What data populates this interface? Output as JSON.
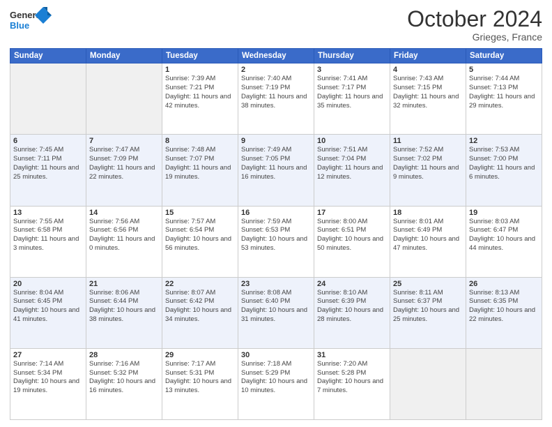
{
  "header": {
    "logo_general": "General",
    "logo_blue": "Blue",
    "title": "October 2024",
    "subtitle": "Grieges, France"
  },
  "weekdays": [
    "Sunday",
    "Monday",
    "Tuesday",
    "Wednesday",
    "Thursday",
    "Friday",
    "Saturday"
  ],
  "weeks": [
    [
      {
        "day": "",
        "sunrise": "",
        "sunset": "",
        "daylight": "",
        "empty": true
      },
      {
        "day": "",
        "sunrise": "",
        "sunset": "",
        "daylight": "",
        "empty": true
      },
      {
        "day": "1",
        "sunrise": "Sunrise: 7:39 AM",
        "sunset": "Sunset: 7:21 PM",
        "daylight": "Daylight: 11 hours and 42 minutes."
      },
      {
        "day": "2",
        "sunrise": "Sunrise: 7:40 AM",
        "sunset": "Sunset: 7:19 PM",
        "daylight": "Daylight: 11 hours and 38 minutes."
      },
      {
        "day": "3",
        "sunrise": "Sunrise: 7:41 AM",
        "sunset": "Sunset: 7:17 PM",
        "daylight": "Daylight: 11 hours and 35 minutes."
      },
      {
        "day": "4",
        "sunrise": "Sunrise: 7:43 AM",
        "sunset": "Sunset: 7:15 PM",
        "daylight": "Daylight: 11 hours and 32 minutes."
      },
      {
        "day": "5",
        "sunrise": "Sunrise: 7:44 AM",
        "sunset": "Sunset: 7:13 PM",
        "daylight": "Daylight: 11 hours and 29 minutes."
      }
    ],
    [
      {
        "day": "6",
        "sunrise": "Sunrise: 7:45 AM",
        "sunset": "Sunset: 7:11 PM",
        "daylight": "Daylight: 11 hours and 25 minutes."
      },
      {
        "day": "7",
        "sunrise": "Sunrise: 7:47 AM",
        "sunset": "Sunset: 7:09 PM",
        "daylight": "Daylight: 11 hours and 22 minutes."
      },
      {
        "day": "8",
        "sunrise": "Sunrise: 7:48 AM",
        "sunset": "Sunset: 7:07 PM",
        "daylight": "Daylight: 11 hours and 19 minutes."
      },
      {
        "day": "9",
        "sunrise": "Sunrise: 7:49 AM",
        "sunset": "Sunset: 7:05 PM",
        "daylight": "Daylight: 11 hours and 16 minutes."
      },
      {
        "day": "10",
        "sunrise": "Sunrise: 7:51 AM",
        "sunset": "Sunset: 7:04 PM",
        "daylight": "Daylight: 11 hours and 12 minutes."
      },
      {
        "day": "11",
        "sunrise": "Sunrise: 7:52 AM",
        "sunset": "Sunset: 7:02 PM",
        "daylight": "Daylight: 11 hours and 9 minutes."
      },
      {
        "day": "12",
        "sunrise": "Sunrise: 7:53 AM",
        "sunset": "Sunset: 7:00 PM",
        "daylight": "Daylight: 11 hours and 6 minutes."
      }
    ],
    [
      {
        "day": "13",
        "sunrise": "Sunrise: 7:55 AM",
        "sunset": "Sunset: 6:58 PM",
        "daylight": "Daylight: 11 hours and 3 minutes."
      },
      {
        "day": "14",
        "sunrise": "Sunrise: 7:56 AM",
        "sunset": "Sunset: 6:56 PM",
        "daylight": "Daylight: 11 hours and 0 minutes."
      },
      {
        "day": "15",
        "sunrise": "Sunrise: 7:57 AM",
        "sunset": "Sunset: 6:54 PM",
        "daylight": "Daylight: 10 hours and 56 minutes."
      },
      {
        "day": "16",
        "sunrise": "Sunrise: 7:59 AM",
        "sunset": "Sunset: 6:53 PM",
        "daylight": "Daylight: 10 hours and 53 minutes."
      },
      {
        "day": "17",
        "sunrise": "Sunrise: 8:00 AM",
        "sunset": "Sunset: 6:51 PM",
        "daylight": "Daylight: 10 hours and 50 minutes."
      },
      {
        "day": "18",
        "sunrise": "Sunrise: 8:01 AM",
        "sunset": "Sunset: 6:49 PM",
        "daylight": "Daylight: 10 hours and 47 minutes."
      },
      {
        "day": "19",
        "sunrise": "Sunrise: 8:03 AM",
        "sunset": "Sunset: 6:47 PM",
        "daylight": "Daylight: 10 hours and 44 minutes."
      }
    ],
    [
      {
        "day": "20",
        "sunrise": "Sunrise: 8:04 AM",
        "sunset": "Sunset: 6:45 PM",
        "daylight": "Daylight: 10 hours and 41 minutes."
      },
      {
        "day": "21",
        "sunrise": "Sunrise: 8:06 AM",
        "sunset": "Sunset: 6:44 PM",
        "daylight": "Daylight: 10 hours and 38 minutes."
      },
      {
        "day": "22",
        "sunrise": "Sunrise: 8:07 AM",
        "sunset": "Sunset: 6:42 PM",
        "daylight": "Daylight: 10 hours and 34 minutes."
      },
      {
        "day": "23",
        "sunrise": "Sunrise: 8:08 AM",
        "sunset": "Sunset: 6:40 PM",
        "daylight": "Daylight: 10 hours and 31 minutes."
      },
      {
        "day": "24",
        "sunrise": "Sunrise: 8:10 AM",
        "sunset": "Sunset: 6:39 PM",
        "daylight": "Daylight: 10 hours and 28 minutes."
      },
      {
        "day": "25",
        "sunrise": "Sunrise: 8:11 AM",
        "sunset": "Sunset: 6:37 PM",
        "daylight": "Daylight: 10 hours and 25 minutes."
      },
      {
        "day": "26",
        "sunrise": "Sunrise: 8:13 AM",
        "sunset": "Sunset: 6:35 PM",
        "daylight": "Daylight: 10 hours and 22 minutes."
      }
    ],
    [
      {
        "day": "27",
        "sunrise": "Sunrise: 7:14 AM",
        "sunset": "Sunset: 5:34 PM",
        "daylight": "Daylight: 10 hours and 19 minutes."
      },
      {
        "day": "28",
        "sunrise": "Sunrise: 7:16 AM",
        "sunset": "Sunset: 5:32 PM",
        "daylight": "Daylight: 10 hours and 16 minutes."
      },
      {
        "day": "29",
        "sunrise": "Sunrise: 7:17 AM",
        "sunset": "Sunset: 5:31 PM",
        "daylight": "Daylight: 10 hours and 13 minutes."
      },
      {
        "day": "30",
        "sunrise": "Sunrise: 7:18 AM",
        "sunset": "Sunset: 5:29 PM",
        "daylight": "Daylight: 10 hours and 10 minutes."
      },
      {
        "day": "31",
        "sunrise": "Sunrise: 7:20 AM",
        "sunset": "Sunset: 5:28 PM",
        "daylight": "Daylight: 10 hours and 7 minutes."
      },
      {
        "day": "",
        "sunrise": "",
        "sunset": "",
        "daylight": "",
        "empty": true
      },
      {
        "day": "",
        "sunrise": "",
        "sunset": "",
        "daylight": "",
        "empty": true
      }
    ]
  ]
}
